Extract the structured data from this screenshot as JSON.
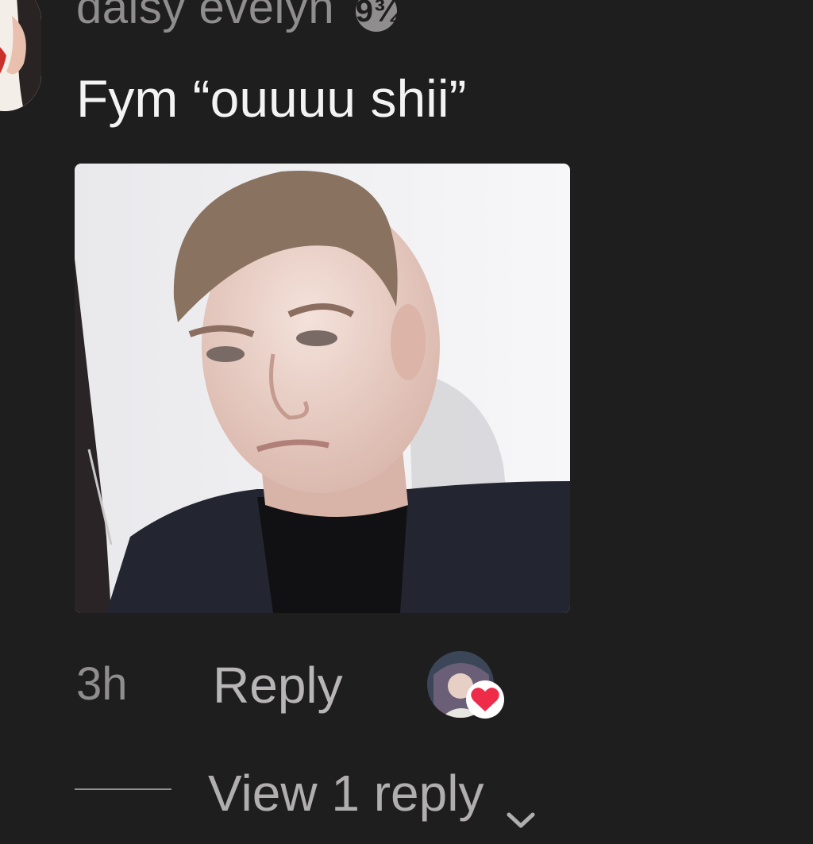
{
  "comment": {
    "username": "daisy evelyn",
    "badge_text": "9¾",
    "text": "Fym “ouuuu shii”",
    "time": "3h",
    "reply_label": "Reply",
    "view_replies_label": "View 1 reply"
  },
  "icons": {
    "like": "heart-icon",
    "expand": "chevron-down-icon"
  },
  "colors": {
    "background": "#1f1e1f",
    "muted_text": "#8f8d8e",
    "heart": "#ee2c4a"
  }
}
